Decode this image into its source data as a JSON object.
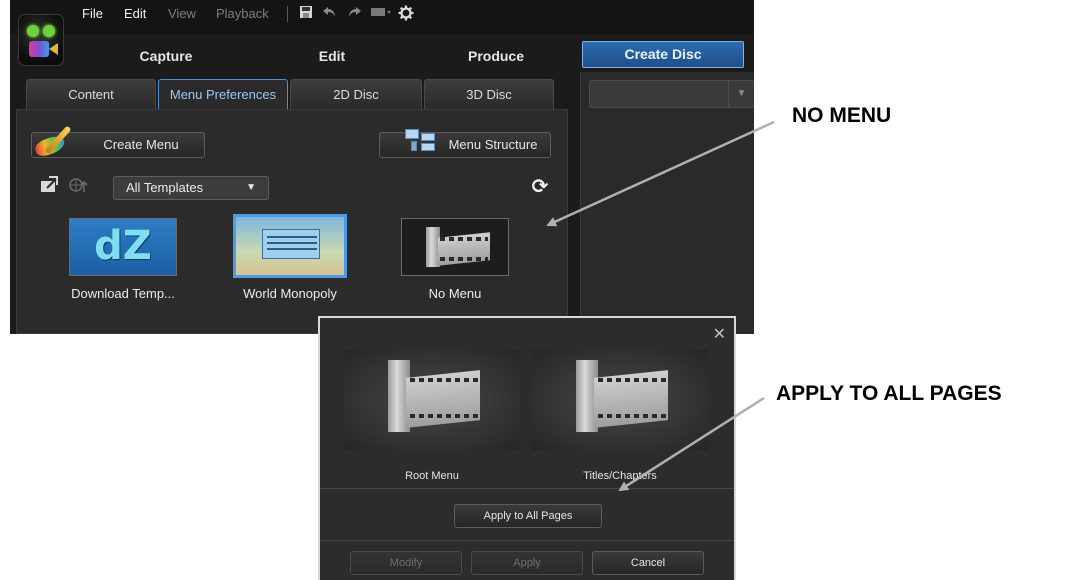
{
  "menubar": {
    "file": "File",
    "edit": "Edit",
    "view": "View",
    "playback": "Playback"
  },
  "icons": {
    "save": "save-icon",
    "undo": "undo-icon",
    "redo": "redo-icon",
    "display": "display-icon",
    "settings": "gear-icon"
  },
  "modes": {
    "capture": "Capture",
    "edit": "Edit",
    "produce": "Produce",
    "create_disc": "Create Disc"
  },
  "tabs": [
    {
      "label": "Content",
      "active": false
    },
    {
      "label": "Menu Preferences",
      "active": true
    },
    {
      "label": "2D Disc",
      "active": false
    },
    {
      "label": "3D Disc",
      "active": false
    }
  ],
  "panel": {
    "create_menu": "Create Menu",
    "menu_structure": "Menu Structure",
    "template_filter": "All Templates"
  },
  "templates": [
    {
      "label": "Download Temp...",
      "thumb_text": "dZ",
      "selected": false
    },
    {
      "label": "World Monopoly",
      "selected": true
    },
    {
      "label": "No Menu",
      "selected": false
    }
  ],
  "dialog": {
    "close": "✕",
    "root_menu": "Root Menu",
    "titles_chapters": "Titles/Chapters",
    "apply_all": "Apply to All Pages",
    "modify": "Modify",
    "apply": "Apply",
    "cancel": "Cancel"
  },
  "annotations": {
    "no_menu": "NO MENU",
    "apply_all_pages": "APPLY TO ALL PAGES"
  },
  "colors": {
    "accent": "#4c9be8",
    "create_disc_bg": "#2d6bb0",
    "background": "#1b1b1b"
  }
}
